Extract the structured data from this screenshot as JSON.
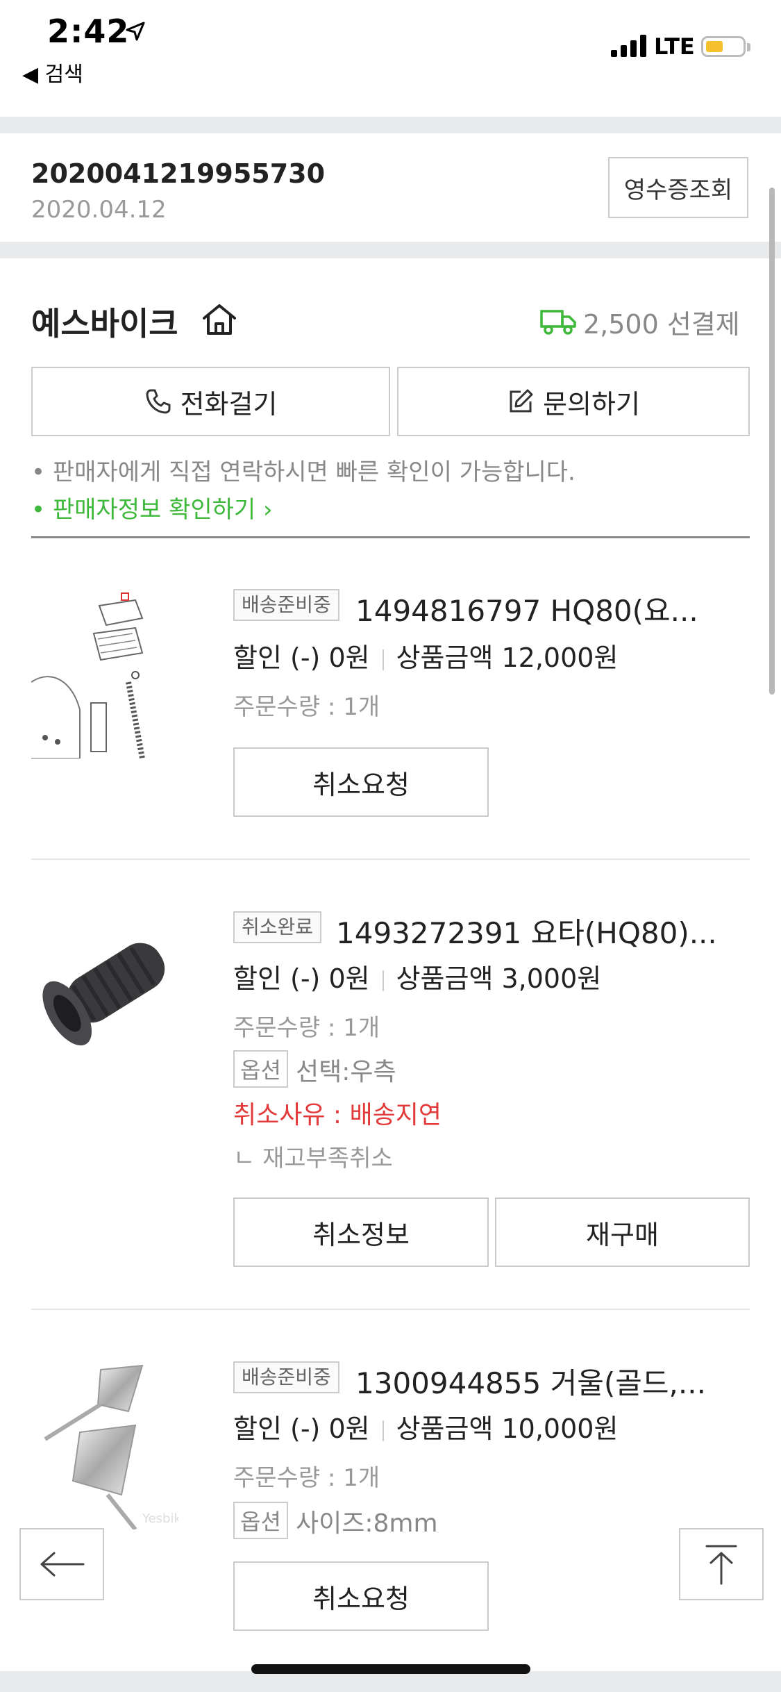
{
  "status_bar": {
    "time": "2:42",
    "back_app": "◀ 검색",
    "network": "LTE"
  },
  "order": {
    "number": "2020041219955730",
    "date": "2020.04.12",
    "receipt_button": "영수증조회"
  },
  "seller": {
    "name": "예스바이크",
    "shipping_fee": "2,500 선결제",
    "call_button": "전화걸기",
    "inquiry_button": "문의하기",
    "note": "• 판매자에게 직접 연락하시면 빠른 확인이 가능합니다.",
    "seller_info_link": "• 판매자정보 확인하기 ›"
  },
  "items": [
    {
      "status": "배송준비중",
      "title": "1494816797 HQ80(요...",
      "discount": "할인 (-) 0원",
      "price": "상품금액 12,000원",
      "quantity": "주문수량 : 1개",
      "buttons": [
        "취소요청"
      ]
    },
    {
      "status": "취소완료",
      "title": "1493272391 요타(HQ80)...",
      "discount": "할인 (-) 0원",
      "price": "상품금액 3,000원",
      "quantity": "주문수량 : 1개",
      "option_label": "옵션",
      "option_value": "선택:우측",
      "cancel_reason": "취소사유 : 배송지연",
      "cancel_detail": "ㄴ 재고부족취소",
      "buttons": [
        "취소정보",
        "재구매"
      ]
    },
    {
      "status": "배송준비중",
      "title": "1300944855 거울(골드,...",
      "discount": "할인 (-) 0원",
      "price": "상품금액 10,000원",
      "quantity": "주문수량 : 1개",
      "option_label": "옵션",
      "option_value": "사이즈:8mm",
      "watermark": "Yesbike",
      "buttons": [
        "취소요청"
      ]
    }
  ],
  "colors": {
    "accent_green": "#3db83a",
    "cancel_red": "#e23a3a",
    "battery_yellow": "#f5c12e"
  },
  "icons": [
    "location-arrow-icon",
    "signal-icon",
    "battery-icon",
    "home-icon",
    "truck-icon",
    "phone-icon",
    "edit-icon",
    "back-arrow-icon",
    "scroll-top-icon"
  ]
}
